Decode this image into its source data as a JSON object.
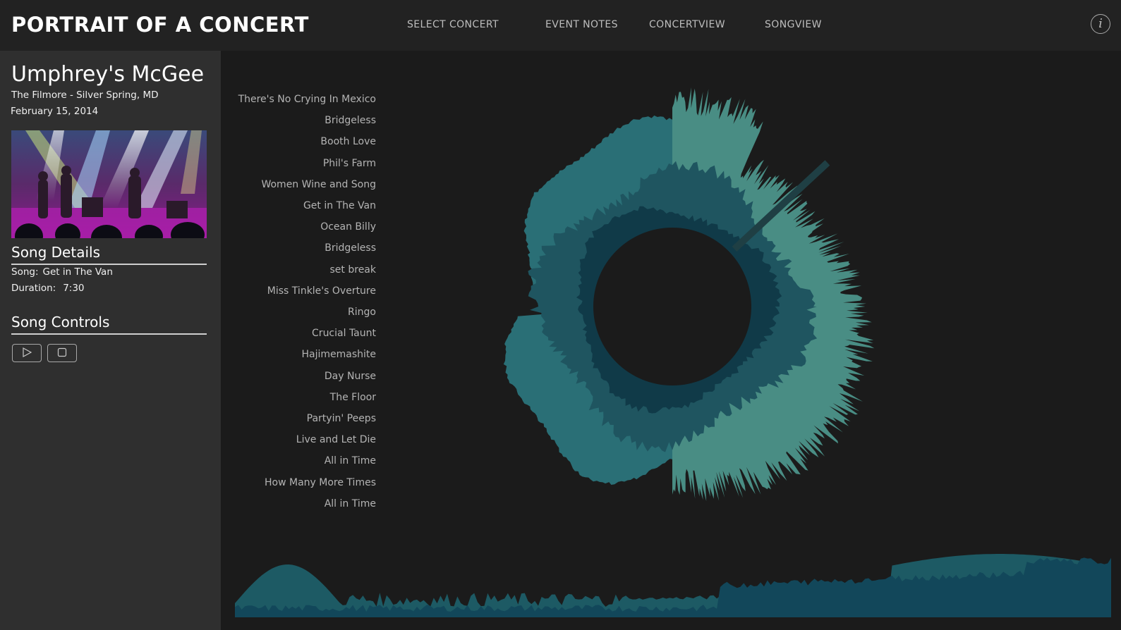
{
  "header": {
    "app_title": "PORTRAIT OF A CONCERT",
    "nav": [
      {
        "label": "SELECT CONCERT"
      },
      {
        "label": "EVENT NOTES"
      },
      {
        "label": "CONCERTVIEW"
      },
      {
        "label": "SONGVIEW"
      }
    ],
    "info_glyph": "i"
  },
  "concert": {
    "artist": "Umphrey's McGee",
    "venue": "The Filmore - Silver Spring, MD",
    "date": "February 15, 2014"
  },
  "song_details": {
    "title": "Song Details",
    "song_label": "Song:",
    "song_value": "Get in The Van",
    "duration_label": "Duration:",
    "duration_value": "7:30"
  },
  "song_controls": {
    "title": "Song Controls",
    "play_icon": "play-icon",
    "stop_icon": "stop-icon"
  },
  "setlist": [
    "There's No Crying In Mexico",
    "Bridgeless",
    "Booth Love",
    "Phil's Farm",
    "Women Wine and Song",
    "Get in The Van",
    "Ocean Billy",
    "Bridgeless",
    "set break",
    "Miss Tinkle's Overture",
    "Ringo",
    "Crucial Taunt",
    "Hajimemashite",
    "Day Nurse",
    "The Floor",
    "Partyin' Peeps",
    "Live and Let Die",
    "All in Time",
    "How Many More Times",
    "All in Time"
  ],
  "colors": {
    "outer_ring": "#2a6f76",
    "inner_ring": "#1f5560",
    "core_ring": "#103a48",
    "highlight": "#4f9a90",
    "timeline": "#12475a"
  }
}
